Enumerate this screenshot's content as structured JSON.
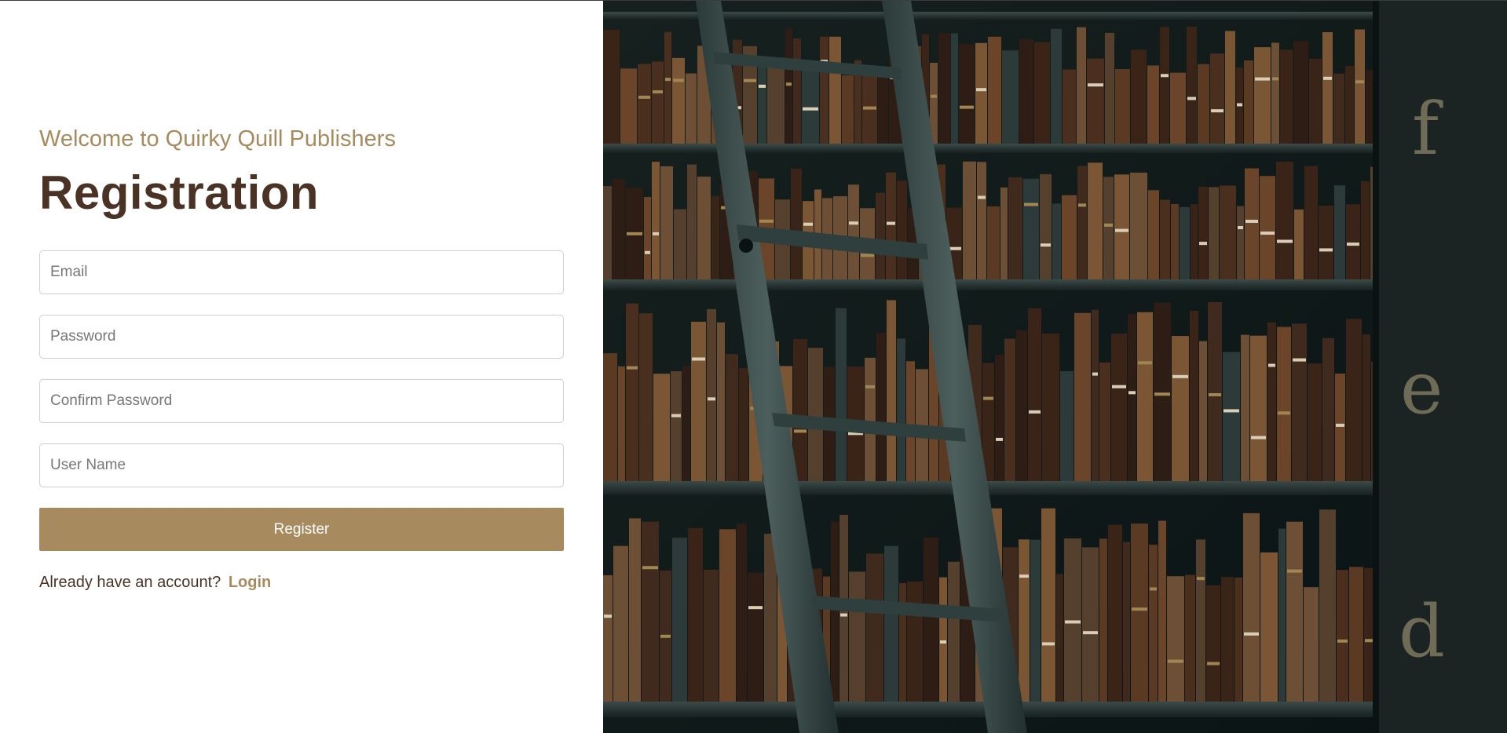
{
  "page": {
    "welcome": "Welcome to Quirky Quill Publishers",
    "title": "Registration"
  },
  "form": {
    "email_placeholder": "Email",
    "password_placeholder": "Password",
    "confirm_password_placeholder": "Confirm Password",
    "username_placeholder": "User Name",
    "register_label": "Register"
  },
  "footer": {
    "prompt": "Already have an account?",
    "login_label": "Login"
  },
  "image": {
    "subject": "library bookshelves with rolling ladder",
    "letters": [
      "f",
      "e",
      "d"
    ]
  },
  "colors": {
    "accent": "#a88a5f",
    "heading": "#4a3325",
    "panel_dark": "#0f1a1b"
  }
}
